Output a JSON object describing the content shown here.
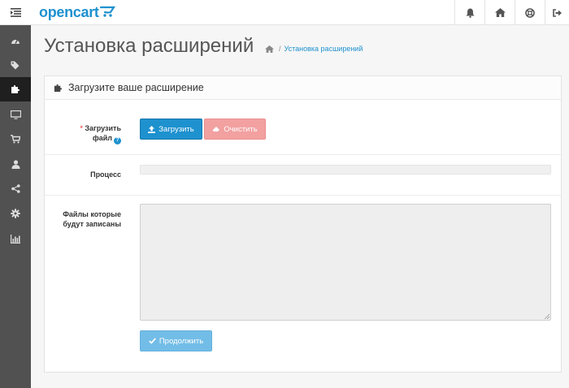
{
  "header": {
    "logo_text": "opencart",
    "buttons": [
      "bell-icon",
      "home-icon",
      "lifebuoy-icon",
      "logout-icon"
    ]
  },
  "sidebar": {
    "items": [
      "dashboard-icon",
      "tags-icon",
      "puzzle-icon",
      "desktop-icon",
      "cart-icon",
      "user-icon",
      "share-icon",
      "gear-icon",
      "bar-chart-icon"
    ],
    "active_index": 2
  },
  "page": {
    "title": "Установка расширений",
    "breadcrumb": {
      "separator": "/",
      "current": "Установка расширений"
    }
  },
  "panel": {
    "title": "Загрузите ваше расширение",
    "upload_label_required": "*",
    "upload_label_line1": "Загрузить",
    "upload_label_line2": "файл",
    "upload_button": "Загрузить",
    "clear_button": "Очистить",
    "progress_label": "Процесс",
    "progress_value": 0,
    "files_label_line1": "Файлы которые",
    "files_label_line2": "будут записаны",
    "files_value": "",
    "continue_button": "Продолжить"
  },
  "colors": {
    "brand": "#1e91cf",
    "danger_light": "#f2a0a0",
    "primary_light": "#72bde7",
    "sidebar": "#515151"
  }
}
